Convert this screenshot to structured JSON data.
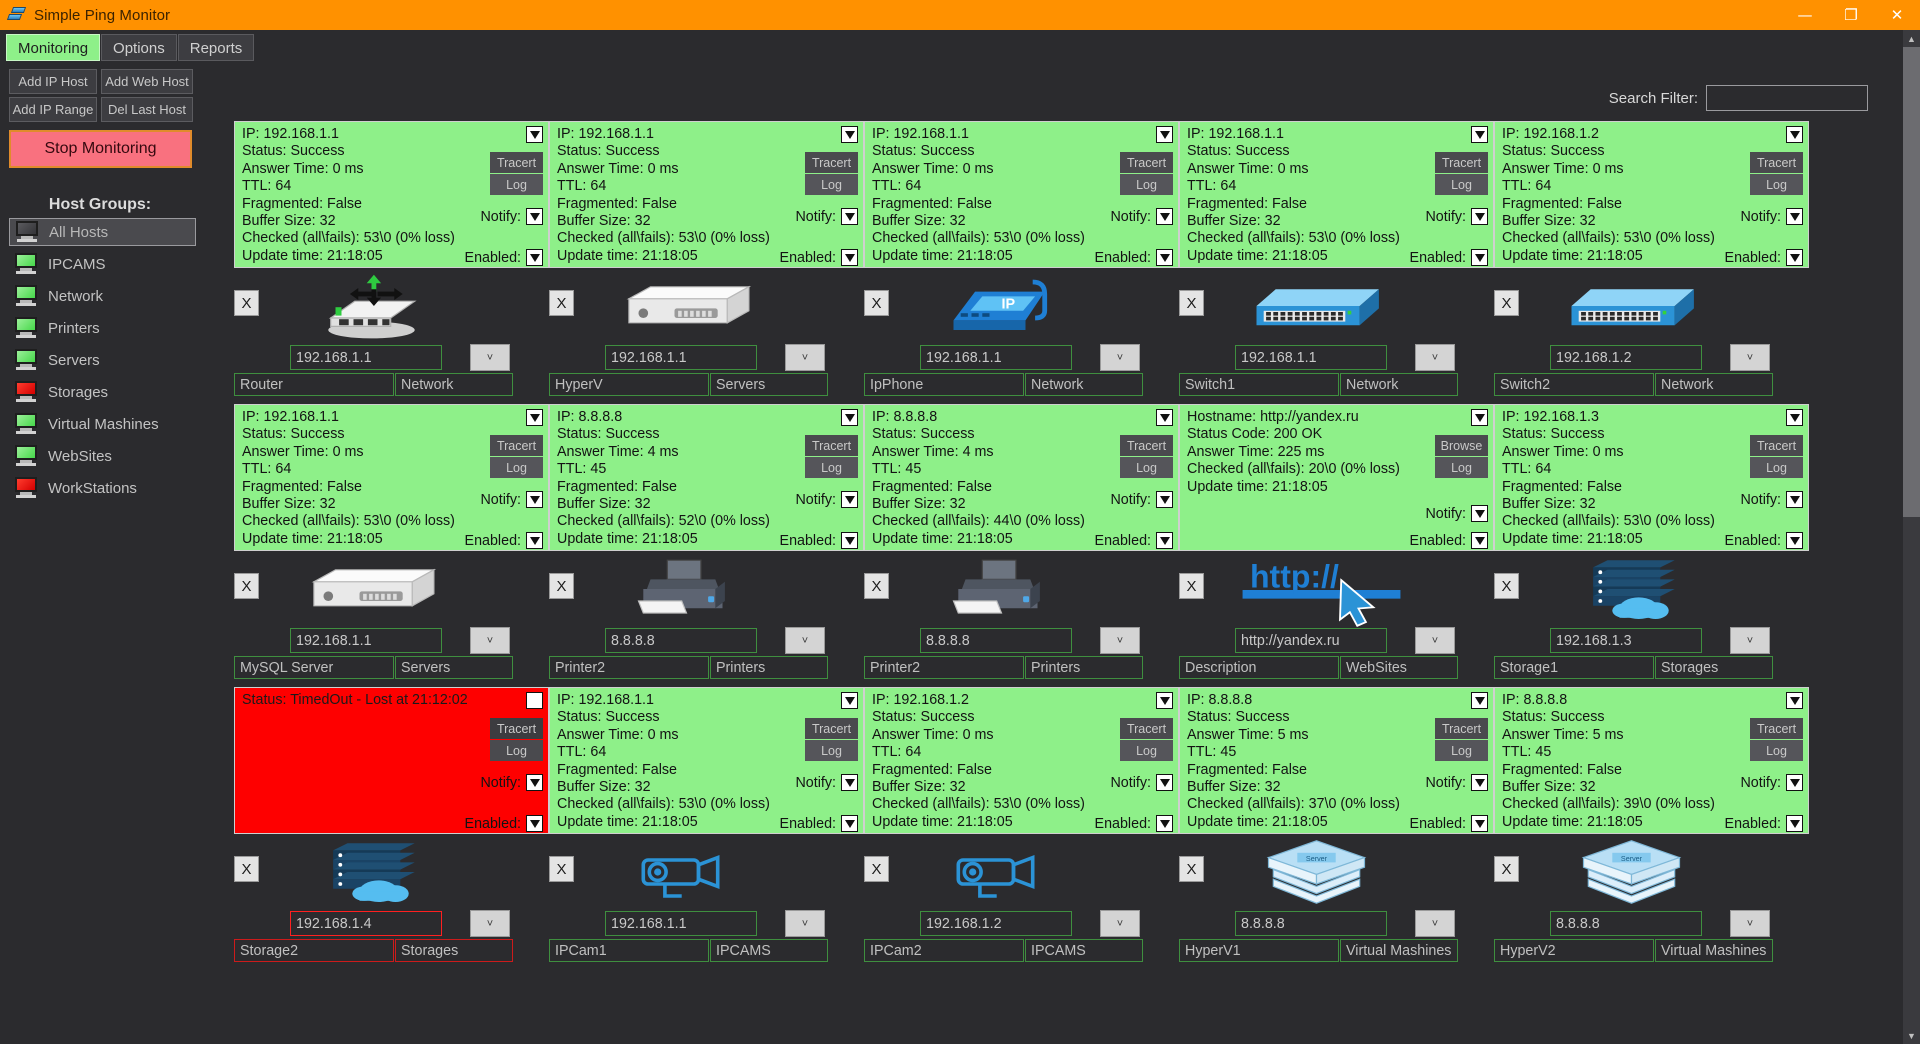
{
  "window": {
    "title": "Simple Ping Monitor",
    "icon": "app-icon",
    "minimize": "—",
    "maximize": "❐",
    "close": "✕"
  },
  "menu": {
    "tabs": [
      {
        "label": "Monitoring",
        "active": true
      },
      {
        "label": "Options",
        "active": false
      },
      {
        "label": "Reports",
        "active": false
      }
    ]
  },
  "sidebar": {
    "buttons": [
      {
        "label": "Add IP Host"
      },
      {
        "label": "Add Web Host"
      },
      {
        "label": "Add IP Range"
      },
      {
        "label": "Del Last Host"
      }
    ],
    "stop_button": "Stop Monitoring",
    "groups_title": "Host Groups:",
    "groups": [
      {
        "label": "All Hosts",
        "state": "gray",
        "selected": true
      },
      {
        "label": "IPCAMS",
        "state": "green",
        "selected": false
      },
      {
        "label": "Network",
        "state": "green",
        "selected": false
      },
      {
        "label": "Printers",
        "state": "green",
        "selected": false
      },
      {
        "label": "Servers",
        "state": "green",
        "selected": false
      },
      {
        "label": "Storages",
        "state": "red",
        "selected": false
      },
      {
        "label": "Virtual Mashines",
        "state": "green",
        "selected": false
      },
      {
        "label": "WebSites",
        "state": "green",
        "selected": false
      },
      {
        "label": "WorkStations",
        "state": "red",
        "selected": false
      }
    ]
  },
  "search": {
    "label": "Search Filter:",
    "value": "",
    "placeholder": ""
  },
  "card_common": {
    "tracert": "Tracert",
    "log": "Log",
    "browse": "Browse",
    "notify": "Notify:",
    "enabled": "Enabled:",
    "delete": "X",
    "dropdown_glyph": "˅"
  },
  "cards": [
    {
      "type": "ip",
      "status": "up",
      "icon": "router-icon",
      "lines": [
        "IP: 192.168.1.1",
        "Status: Success",
        "Answer Time: 0 ms",
        "TTL: 64",
        "Fragmented: False",
        "Buffer Size: 32",
        "Checked (all\\fails): 53\\0 (0% loss)",
        "Update time: 21:18:05"
      ],
      "ip": "192.168.1.1",
      "name": "Router",
      "group": "Network",
      "notify_checked": true,
      "enabled_checked": true,
      "top_checked": true
    },
    {
      "type": "ip",
      "status": "up",
      "icon": "server-icon",
      "lines": [
        "IP: 192.168.1.1",
        "Status: Success",
        "Answer Time: 0 ms",
        "TTL: 64",
        "Fragmented: False",
        "Buffer Size: 32",
        "Checked (all\\fails): 53\\0 (0% loss)",
        "Update time: 21:18:05"
      ],
      "ip": "192.168.1.1",
      "name": "HyperV",
      "group": "Servers",
      "notify_checked": true,
      "enabled_checked": true,
      "top_checked": true
    },
    {
      "type": "ip",
      "status": "up",
      "icon": "ipphone-icon",
      "lines": [
        "IP: 192.168.1.1",
        "Status: Success",
        "Answer Time: 0 ms",
        "TTL: 64",
        "Fragmented: False",
        "Buffer Size: 32",
        "Checked (all\\fails): 53\\0 (0% loss)",
        "Update time: 21:18:05"
      ],
      "ip": "192.168.1.1",
      "name": "IpPhone",
      "group": "Network",
      "notify_checked": true,
      "enabled_checked": true,
      "top_checked": true
    },
    {
      "type": "ip",
      "status": "up",
      "icon": "switch-icon",
      "lines": [
        "IP: 192.168.1.1",
        "Status: Success",
        "Answer Time: 0 ms",
        "TTL: 64",
        "Fragmented: False",
        "Buffer Size: 32",
        "Checked (all\\fails): 53\\0 (0% loss)",
        "Update time: 21:18:05"
      ],
      "ip": "192.168.1.1",
      "name": "Switch1",
      "group": "Network",
      "notify_checked": true,
      "enabled_checked": true,
      "top_checked": true
    },
    {
      "type": "ip",
      "status": "up",
      "icon": "switch-icon",
      "lines": [
        "IP: 192.168.1.2",
        "Status: Success",
        "Answer Time: 0 ms",
        "TTL: 64",
        "Fragmented: False",
        "Buffer Size: 32",
        "Checked (all\\fails): 53\\0 (0% loss)",
        "Update time: 21:18:05"
      ],
      "ip": "192.168.1.2",
      "name": "Switch2",
      "group": "Network",
      "notify_checked": true,
      "enabled_checked": true,
      "top_checked": true
    },
    {
      "type": "ip",
      "status": "up",
      "icon": "server-icon",
      "lines": [
        "IP: 192.168.1.1",
        "Status: Success",
        "Answer Time: 0 ms",
        "TTL: 64",
        "Fragmented: False",
        "Buffer Size: 32",
        "Checked (all\\fails): 53\\0 (0% loss)",
        "Update time: 21:18:05"
      ],
      "ip": "192.168.1.1",
      "name": "MySQL Server",
      "group": "Servers",
      "notify_checked": true,
      "enabled_checked": true,
      "top_checked": true
    },
    {
      "type": "ip",
      "status": "up",
      "icon": "printer-icon",
      "lines": [
        "IP: 8.8.8.8",
        "Status: Success",
        "Answer Time: 4 ms",
        "TTL: 45",
        "Fragmented: False",
        "Buffer Size: 32",
        "Checked (all\\fails): 52\\0 (0% loss)",
        "Update time: 21:18:05"
      ],
      "ip": "8.8.8.8",
      "name": "Printer2",
      "group": "Printers",
      "notify_checked": true,
      "enabled_checked": true,
      "top_checked": true
    },
    {
      "type": "ip",
      "status": "up",
      "icon": "printer-icon",
      "lines": [
        "IP: 8.8.8.8",
        "Status: Success",
        "Answer Time: 4 ms",
        "TTL: 45",
        "Fragmented: False",
        "Buffer Size: 32",
        "Checked (all\\fails): 44\\0 (0% loss)",
        "Update time: 21:18:05"
      ],
      "ip": "8.8.8.8",
      "name": "Printer2",
      "group": "Printers",
      "notify_checked": true,
      "enabled_checked": true,
      "top_checked": true
    },
    {
      "type": "web",
      "status": "up",
      "icon": "http-icon",
      "lines": [
        "Hostname: http://yandex.ru",
        "Status Code: 200 OK",
        "Answer Time: 225 ms",
        "Checked (all\\fails): 20\\0 (0% loss)",
        "Update time: 21:18:05"
      ],
      "ip": "http://yandex.ru",
      "name": "Description",
      "group": "WebSites",
      "notify_checked": true,
      "enabled_checked": true,
      "top_checked": true
    },
    {
      "type": "ip",
      "status": "up",
      "icon": "storage-icon",
      "lines": [
        "IP: 192.168.1.3",
        "Status: Success",
        "Answer Time: 0 ms",
        "TTL: 64",
        "Fragmented: False",
        "Buffer Size: 32",
        "Checked (all\\fails): 53\\0 (0% loss)",
        "Update time: 21:18:05"
      ],
      "ip": "192.168.1.3",
      "name": "Storage1",
      "group": "Storages",
      "notify_checked": true,
      "enabled_checked": true,
      "top_checked": true
    },
    {
      "type": "ip",
      "status": "down",
      "icon": "storage-icon",
      "selected": true,
      "lines": [
        "Status: TimedOut - Lost at 21:12:02"
      ],
      "ip": "192.168.1.4",
      "name": "Storage2",
      "group": "Storages",
      "notify_checked": true,
      "enabled_checked": true,
      "top_checked": false
    },
    {
      "type": "ip",
      "status": "up",
      "icon": "ipcam-icon",
      "lines": [
        "IP: 192.168.1.1",
        "Status: Success",
        "Answer Time: 0 ms",
        "TTL: 64",
        "Fragmented: False",
        "Buffer Size: 32",
        "Checked (all\\fails): 53\\0 (0% loss)",
        "Update time: 21:18:05"
      ],
      "ip": "192.168.1.1",
      "name": "IPCam1",
      "group": "IPCAMS",
      "notify_checked": true,
      "enabled_checked": true,
      "top_checked": true
    },
    {
      "type": "ip",
      "status": "up",
      "icon": "ipcam-icon",
      "lines": [
        "IP: 192.168.1.2",
        "Status: Success",
        "Answer Time: 0 ms",
        "TTL: 64",
        "Fragmented: False",
        "Buffer Size: 32",
        "Checked (all\\fails): 53\\0 (0% loss)",
        "Update time: 21:18:05"
      ],
      "ip": "192.168.1.2",
      "name": "IPCam2",
      "group": "IPCAMS",
      "notify_checked": true,
      "enabled_checked": true,
      "top_checked": true
    },
    {
      "type": "ip",
      "status": "up",
      "icon": "datacenter-icon",
      "lines": [
        "IP: 8.8.8.8",
        "Status: Success",
        "Answer Time: 5 ms",
        "TTL: 45",
        "Fragmented: False",
        "Buffer Size: 32",
        "Checked (all\\fails): 37\\0 (0% loss)",
        "Update time: 21:18:05"
      ],
      "ip": "8.8.8.8",
      "name": "HyperV1",
      "group": "Virtual Mashines",
      "notify_checked": true,
      "enabled_checked": true,
      "top_checked": true
    },
    {
      "type": "ip",
      "status": "up",
      "icon": "datacenter-icon",
      "lines": [
        "IP: 8.8.8.8",
        "Status: Success",
        "Answer Time: 5 ms",
        "TTL: 45",
        "Fragmented: False",
        "Buffer Size: 32",
        "Checked (all\\fails): 39\\0 (0% loss)",
        "Update time: 21:18:05"
      ],
      "ip": "8.8.8.8",
      "name": "HyperV2",
      "group": "Virtual Mashines",
      "notify_checked": true,
      "enabled_checked": true,
      "top_checked": true
    }
  ],
  "scrollbar": {
    "up": "▲",
    "down": "▼"
  },
  "colors": {
    "titlebar": "#ff9100",
    "background": "#2b2b2e",
    "up": "#8ef089",
    "down": "#fe0000",
    "accent_green": "#8ef089",
    "stop": "#f9717f"
  }
}
